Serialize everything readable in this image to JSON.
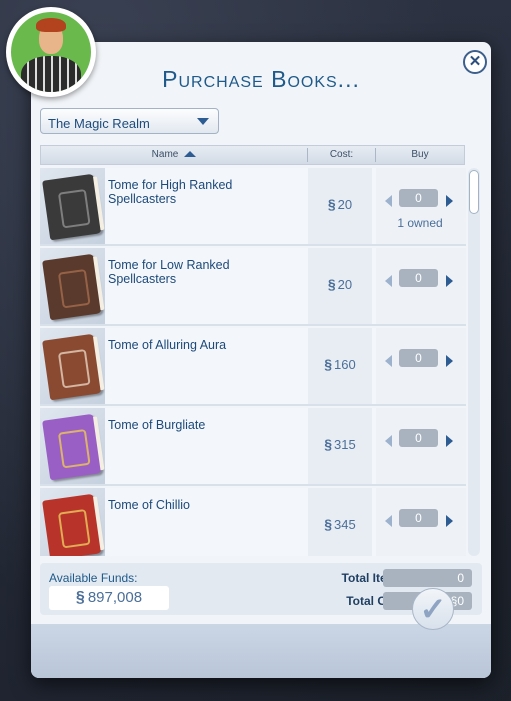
{
  "dialog": {
    "title": "Purchase Books...",
    "close_icon": "close-icon",
    "confirm_icon": "checkmark-icon"
  },
  "category_dropdown": {
    "selected": "The Magic Realm"
  },
  "table": {
    "headers": {
      "name": "Name",
      "cost": "Cost:",
      "buy": "Buy"
    },
    "sort_column": "Name",
    "sort_direction": "ascending",
    "items": [
      {
        "name": "Tome for High Ranked Spellcasters",
        "price": "20",
        "qty": "0",
        "owned": "1 owned",
        "book_color": "#3a3a3a",
        "emblem_color": "#8b8b8b"
      },
      {
        "name": "Tome for Low Ranked Spellcasters",
        "price": "20",
        "qty": "0",
        "owned": "",
        "book_color": "#5a3a2c",
        "emblem_color": "#a06a4c"
      },
      {
        "name": "Tome of Alluring Aura",
        "price": "160",
        "qty": "0",
        "owned": "",
        "book_color": "#8a4a32",
        "emblem_color": "#e0c9b5"
      },
      {
        "name": "Tome of Burgliate",
        "price": "315",
        "qty": "0",
        "owned": "",
        "book_color": "#9a5fc5",
        "emblem_color": "#e8c25a"
      },
      {
        "name": "Tome of Chillio",
        "price": "345",
        "qty": "0",
        "owned": "",
        "book_color": "#b8332a",
        "emblem_color": "#e8c25a"
      }
    ]
  },
  "currency_symbol": "§",
  "footer": {
    "funds_label": "Available Funds:",
    "funds_value": "897,008",
    "total_items_label": "Total Items:",
    "total_items_value": "0",
    "total_cost_label": "Total Cost:",
    "total_cost_value": "0"
  },
  "colors": {
    "accent": "#1f5a8a",
    "avatar_bg": "#69b94d"
  }
}
